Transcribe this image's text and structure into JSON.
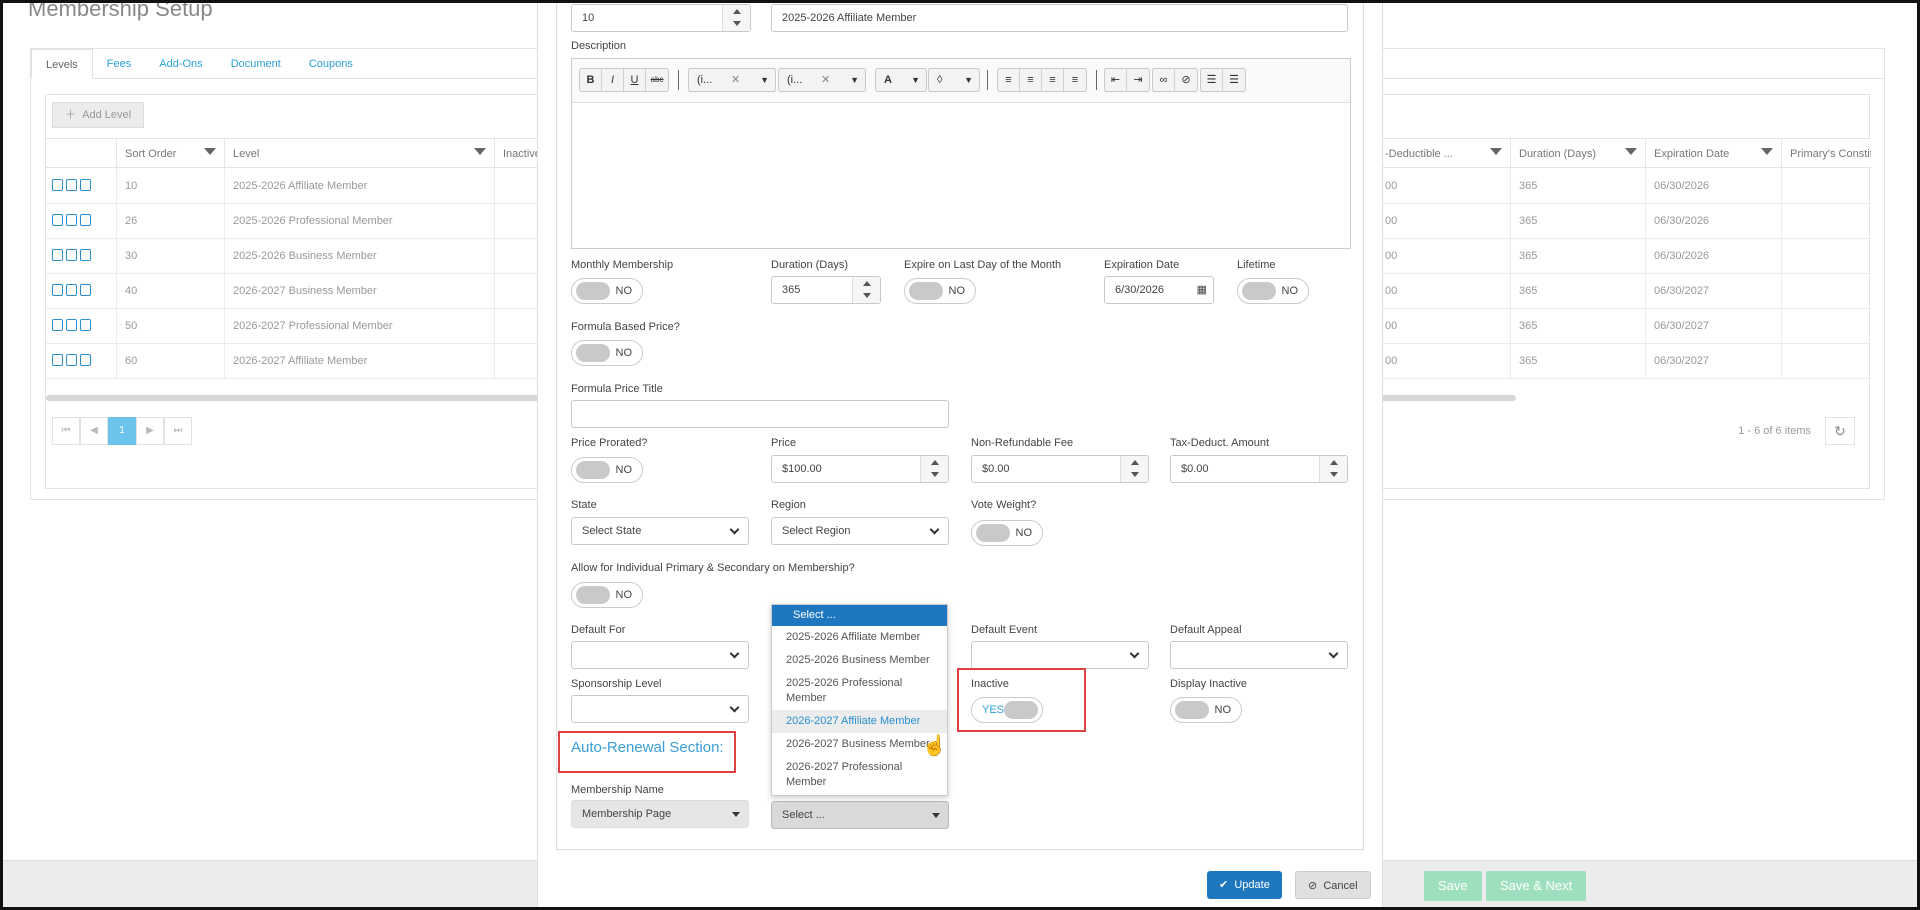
{
  "page": {
    "title": "Membership Setup"
  },
  "bg": {
    "tabs": [
      "Levels",
      "Fees",
      "Add-Ons",
      "Document",
      "Coupons"
    ],
    "add_level": "Add Level",
    "columns_left": [
      "Sort Order",
      "Level",
      "Inactive"
    ],
    "columns_right": [
      "-Deductible ...",
      "Duration (Days)",
      "Expiration Date",
      "Primary's Constitu"
    ],
    "rows": [
      {
        "sort": "10",
        "level": "2025-2026 Affiliate Member",
        "ded": "00",
        "duration": "365",
        "expiration": "06/30/2026"
      },
      {
        "sort": "26",
        "level": "2025-2026 Professional Member",
        "ded": "00",
        "duration": "365",
        "expiration": "06/30/2026"
      },
      {
        "sort": "30",
        "level": "2025-2026 Business Member",
        "ded": "00",
        "duration": "365",
        "expiration": "06/30/2026"
      },
      {
        "sort": "40",
        "level": "2026-2027 Business Member",
        "ded": "00",
        "duration": "365",
        "expiration": "06/30/2027"
      },
      {
        "sort": "50",
        "level": "2026-2027 Professional Member",
        "ded": "00",
        "duration": "365",
        "expiration": "06/30/2027"
      },
      {
        "sort": "60",
        "level": "2026-2027 Affiliate Member",
        "ded": "00",
        "duration": "365",
        "expiration": "06/30/2027"
      }
    ],
    "pager": {
      "first": "⏮",
      "prev": "◀",
      "page": "1",
      "next": "▶",
      "last": "⏭"
    },
    "items_info": "1 - 6 of 6 items",
    "save": "Save",
    "save_next": "Save & Next"
  },
  "form": {
    "sort_order": "10",
    "level_name": "2025-2026 Affiliate Member",
    "description_label": "Description",
    "toolbar": {
      "bold": "B",
      "italic": "I",
      "underline": "U",
      "strike": "abc",
      "font": "(i...",
      "size": "(i...",
      "font_color": "A",
      "bg_color": "◊"
    },
    "monthly_label": "Monthly Membership",
    "duration_label": "Duration (Days)",
    "duration_value": "365",
    "expire_last_label": "Expire on Last Day of the Month",
    "expiration_label": "Expiration Date",
    "expiration_value": "6/30/2026",
    "lifetime_label": "Lifetime",
    "formula_based_label": "Formula Based Price?",
    "formula_title_label": "Formula Price Title",
    "prorated_label": "Price Prorated?",
    "price_label": "Price",
    "price_value": "$100.00",
    "nonrefund_label": "Non-Refundable Fee",
    "nonrefund_value": "$0.00",
    "taxded_label": "Tax-Deduct. Amount",
    "taxded_value": "$0.00",
    "state_label": "State",
    "state_value": "Select State",
    "region_label": "Region",
    "region_value": "Select Region",
    "vote_label": "Vote Weight?",
    "allow_label": "Allow for Individual Primary & Secondary on Membership?",
    "default_for_label": "Default For",
    "default_event_label": "Default Event",
    "default_appeal_label": "Default Appeal",
    "sponsorship_label": "Sponsorship Level",
    "inactive_label": "Inactive",
    "display_inactive_label": "Display Inactive",
    "no": "NO",
    "yes": "YES",
    "auto_renewal_title": "Auto-Renewal Section:",
    "membership_name_label": "Membership Name",
    "membership_name_value": "Membership Page",
    "renewal_select_value": "Select ...",
    "update": "Update",
    "cancel": "Cancel"
  },
  "dropdown": {
    "items": [
      "Select ...",
      "2025-2026 Affiliate Member",
      "2025-2026 Business Member",
      "2025-2026 Professional Member",
      "2026-2027 Affiliate Member",
      "2026-2027 Business Member",
      "2026-2027 Professional Member"
    ]
  },
  "colors": {
    "accent": "#1f77c0",
    "link": "#2aa2d8",
    "highlight": "#e04040",
    "green_btn": "#9ee0bd"
  }
}
